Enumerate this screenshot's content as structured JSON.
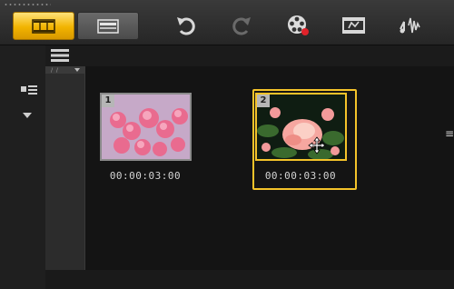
{
  "toolbar": {
    "view_buttons": [
      {
        "name": "storyboard-view",
        "icon": "film-strip-icon",
        "active": true
      },
      {
        "name": "timeline-view",
        "icon": "timeline-icon",
        "active": false
      }
    ],
    "tools": [
      {
        "name": "undo",
        "icon": "undo-icon"
      },
      {
        "name": "redo",
        "icon": "redo-icon"
      },
      {
        "name": "record-capture",
        "icon": "record-capture-icon"
      },
      {
        "name": "auto-music",
        "icon": "auto-music-icon"
      },
      {
        "name": "sound-mixer",
        "icon": "sound-mixer-icon"
      }
    ]
  },
  "clips": [
    {
      "number": "1",
      "duration": "00:00:03:00",
      "selected": false,
      "subject": "pink blossoms"
    },
    {
      "number": "2",
      "duration": "00:00:03:00",
      "selected": true,
      "subject": "pink rose"
    }
  ],
  "colors": {
    "accent": "#f4c32a",
    "background": "#141414",
    "text": "#d4d4d4"
  }
}
